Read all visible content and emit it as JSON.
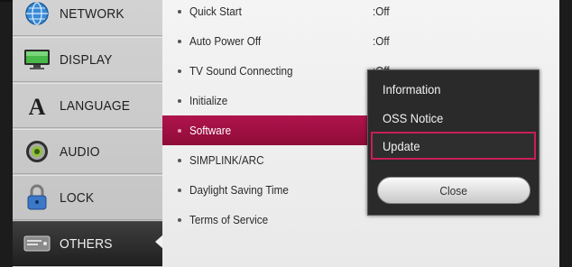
{
  "categories": [
    {
      "label": "NETWORK",
      "icon": "network-globe-icon"
    },
    {
      "label": "DISPLAY",
      "icon": "display-monitor-icon"
    },
    {
      "label": "LANGUAGE",
      "icon": "language-letter-a-icon"
    },
    {
      "label": "AUDIO",
      "icon": "audio-speaker-icon"
    },
    {
      "label": "LOCK",
      "icon": "padlock-icon"
    },
    {
      "label": "OTHERS",
      "icon": "others-box-icon",
      "selected": true
    }
  ],
  "settings": [
    {
      "label": "Quick Start",
      "value": ":Off"
    },
    {
      "label": "Auto Power Off",
      "value": ":Off"
    },
    {
      "label": "TV Sound Connecting",
      "value": ":Off"
    },
    {
      "label": "Initialize",
      "value": ""
    },
    {
      "label": "Software",
      "value": "",
      "highlighted": true
    },
    {
      "label": "SIMPLINK/ARC",
      "value": ""
    },
    {
      "label": "Daylight Saving Time",
      "value": ""
    },
    {
      "label": "Terms of Service",
      "value": ""
    }
  ],
  "popup": {
    "items": [
      {
        "label": "Information"
      },
      {
        "label": "OSS Notice"
      },
      {
        "label": "Update",
        "focused": true
      }
    ],
    "close_label": "Close"
  },
  "colors": {
    "highlight": "#a01044",
    "focus_border": "#c81e5a",
    "popup_bg": "#2a2a2a"
  }
}
